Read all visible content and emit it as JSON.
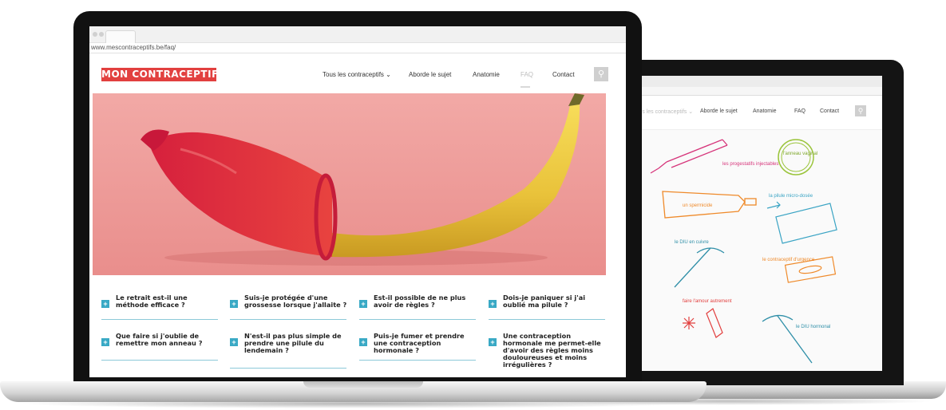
{
  "browser": {
    "url": "www.mescontraceptifs.be/faq/"
  },
  "site": {
    "logo": "MON CONTRACEPTIF",
    "nav": [
      {
        "label": "Tous les contraceptifs ⌄"
      },
      {
        "label": "Aborde le sujet"
      },
      {
        "label": "Anatomie"
      },
      {
        "label": "FAQ"
      },
      {
        "label": "Contact"
      }
    ],
    "search_icon": "search-icon"
  },
  "faq": [
    {
      "question": "Le retrait est-il une méthode efficace ?"
    },
    {
      "question": "Suis-je protégée d'une grossesse lorsque j'allaite ?"
    },
    {
      "question": "Est-il possible de ne plus avoir de règles ?"
    },
    {
      "question": "Dois-je paniquer si j'ai oublié ma pilule ?"
    },
    {
      "question": "Que faire si j'oublie de remettre mon anneau ?"
    },
    {
      "question": "N'est-il pas plus simple de prendre une pilule du lendemain ?"
    },
    {
      "question": "Puis-je fumer et prendre une contraception hormonale ?"
    },
    {
      "question": "Une contraception hormonale me permet-elle d'avoir des règles moins douloureuses et moins irrégulières ?"
    }
  ],
  "back_site": {
    "nav": [
      {
        "label": "Tous les contraceptifs ⌄"
      },
      {
        "label": "Aborde le sujet"
      },
      {
        "label": "Anatomie"
      },
      {
        "label": "FAQ"
      },
      {
        "label": "Contact"
      }
    ],
    "doodles": [
      {
        "label": "les progestatifs injectables"
      },
      {
        "label": "l'anneau vaginal"
      },
      {
        "label": "un spermicide"
      },
      {
        "label": "la pilule micro-dosée"
      },
      {
        "label": "le DIU en cuivre"
      },
      {
        "label": "le contraceptif d'urgence"
      },
      {
        "label": "faire l'amour autrement"
      },
      {
        "label": "le DIU hormonal"
      }
    ]
  },
  "colors": {
    "brand_red": "#e2403f",
    "accent_blue": "#39a9c5",
    "hero_pink": "#ef9c9a"
  }
}
